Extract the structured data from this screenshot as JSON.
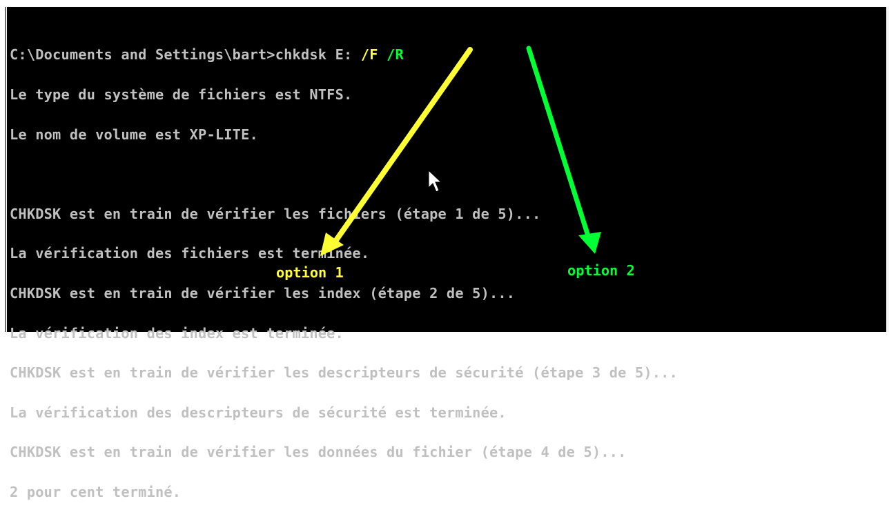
{
  "console": {
    "prompt": "C:\\Documents and Settings\\bart>chkdsk E: ",
    "flag_f": "/F",
    "flag_gap": " ",
    "flag_r": "/R",
    "lines": [
      "Le type du système de fichiers est NTFS.",
      "Le nom de volume est XP-LITE.",
      "",
      "CHKDSK est en train de vérifier les fichiers (étape 1 de 5)...",
      "La vérification des fichiers est terminée.",
      "CHKDSK est en train de vérifier les index (étape 2 de 5)...",
      "La vérification des index est terminée.",
      "CHKDSK est en train de vérifier les descripteurs de sécurité (étape 3 de 5)...",
      "La vérification des descripteurs de sécurité est terminée.",
      "CHKDSK est en train de vérifier les données du fichier (étape 4 de 5)...",
      "2 pour cent terminé."
    ]
  },
  "annotations": {
    "option1_label": "option 1",
    "option2_label": "option 2",
    "option1_color": "#ffff33",
    "option2_color": "#00ff33"
  }
}
